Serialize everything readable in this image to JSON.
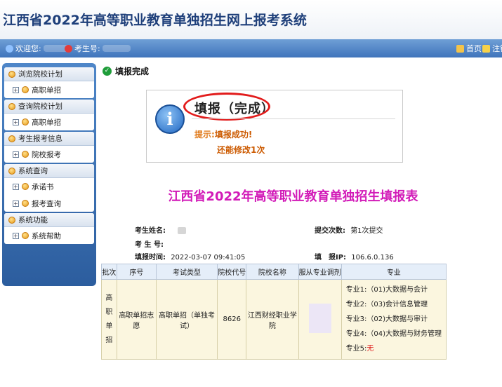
{
  "header": {
    "title": "江西省2022年高等职业教育单独招生网上报考系统"
  },
  "navbar": {
    "welcome_label": "欢迎您:",
    "exam_no_label": "考生号:",
    "home_label": "首页",
    "logout_label": "注销"
  },
  "sidebar": {
    "groups": [
      {
        "title": "浏览院校计划",
        "items": [
          "高职单招"
        ]
      },
      {
        "title": "查询院校计划",
        "items": [
          "高职单招"
        ]
      },
      {
        "title": "考生报考信息",
        "items": [
          "院校报考"
        ]
      },
      {
        "title": "系统查询",
        "items": [
          "承诺书",
          "报考查询"
        ]
      },
      {
        "title": "系统功能",
        "items": [
          "系统帮助"
        ]
      }
    ]
  },
  "page": {
    "heading": "填报完成"
  },
  "message": {
    "title": "填报（完成）",
    "hint_label": "提示:",
    "hint_text": "填报成功!",
    "hint_text2": "还能修改1次"
  },
  "form": {
    "title": "江西省2022年高等职业教育单独招生填报表",
    "name_label": "考生姓名:",
    "exam_no_label": "考 生 号:",
    "time_label": "填报时间:",
    "time_value": "2022-03-07 09:41:05",
    "submit_count_label": "提交次数:",
    "submit_count_value": "第1次提交",
    "ip_label": "填　报IP:",
    "ip_value": "106.6.0.136"
  },
  "table": {
    "headers": [
      "批次",
      "序号",
      "考试类型",
      "院校代号",
      "院校名称",
      "服从专业调剂",
      "专业"
    ],
    "row": {
      "batch": "高职单招",
      "seq": "高职单招志愿",
      "exam_type": "高职单招（单独考试）",
      "school_code": "8626",
      "school_name": "江西财经职业学院",
      "majors": [
        "专业1:（01)大数据与会计",
        "专业2:（03)会计信息管理",
        "专业3:（02)大数据与审计",
        "专业4:（04)大数据与财务管理"
      ],
      "major5_label": "专业5:",
      "major5_value": "无"
    }
  },
  "colors": {
    "accent": "#3f74bb",
    "form_title": "#d21bb8",
    "highlight_oval": "#e21b1b"
  }
}
